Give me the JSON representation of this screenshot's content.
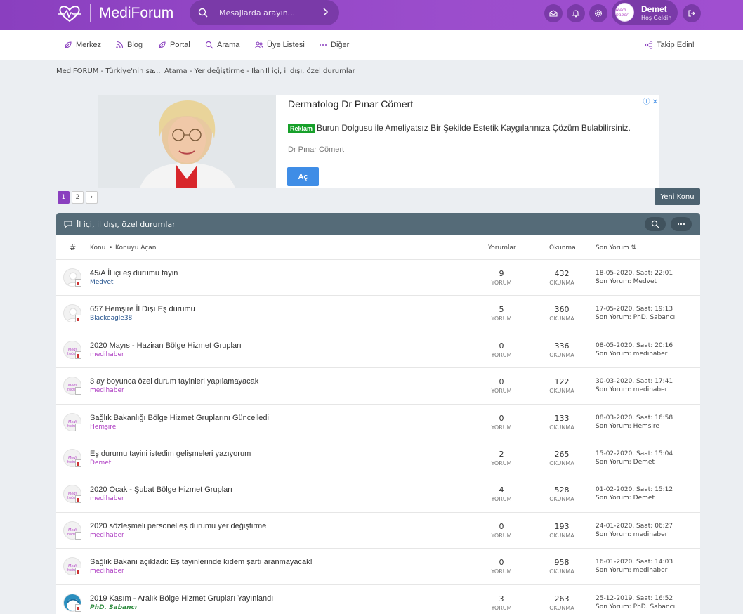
{
  "app": {
    "logo_text": "MediForum",
    "search_placeholder": "Mesajlarda arayın...",
    "user": {
      "name": "Demet",
      "greeting": "Hoş Geldin",
      "avatar_label": "Medi haber"
    }
  },
  "nav": {
    "items": [
      {
        "label": "Merkez",
        "icon": "leaf-icon"
      },
      {
        "label": "Blog",
        "icon": "rss-icon"
      },
      {
        "label": "Portal",
        "icon": "leaf-icon"
      },
      {
        "label": "Arama",
        "icon": "search-icon"
      },
      {
        "label": "Üye Listesi",
        "icon": "users-icon"
      },
      {
        "label": "Diğer",
        "icon": "more-icon"
      }
    ],
    "follow_label": "Takip Edin!"
  },
  "breadcrumb": [
    "MediFORUM - Türkiye'nin sa...",
    "Atama - Yer değiştirme - İlan",
    "İl içi, il dışı, özel durumlar"
  ],
  "ad": {
    "title": "Dermatolog Dr Pınar Cömert",
    "badge": "Reklam",
    "text": "Burun Dolgusu ile Ameliyatsız Bir Şekilde Estetik Kaygılarınıza Çözüm Bulabilirsiniz.",
    "advertiser": "Dr Pınar Cömert",
    "button": "Aç"
  },
  "pagination": {
    "pages": [
      "1",
      "2"
    ],
    "current": "1",
    "next": "›"
  },
  "new_topic_label": "Yeni Konu",
  "forum": {
    "title": "İl içi, il dışı, özel durumlar",
    "columns": {
      "hash": "#",
      "topic": "Konu",
      "starter": "Konuyu Açan",
      "replies": "Yorumlar",
      "views": "Okunma",
      "last": "Son Yorum"
    },
    "reply_unit": "YORUM",
    "view_unit": "OKUNMA",
    "last_prefix": "Son Yorum:",
    "topics": [
      {
        "title": "45/A İl içi eş durumu tayin",
        "author": "Medvet",
        "author_color": "#1f4f8b",
        "avatar": "blank",
        "doc": "red",
        "replies": "9",
        "views": "432",
        "date": "18-05-2020, Saat: 22:01",
        "last_user": "Medvet"
      },
      {
        "title": "657 Hemşire İl Dışı Eş durumu",
        "author": "Blackeagle38",
        "author_color": "#1f4f8b",
        "avatar": "blank",
        "doc": "red",
        "replies": "5",
        "views": "360",
        "date": "17-05-2020, Saat: 19:13",
        "last_user": "PhD. Sabancı"
      },
      {
        "title": "2020 Mayıs - Haziran Bölge Hizmet Grupları",
        "author": "medihaber",
        "author_color": "#b042c4",
        "avatar": "medi",
        "doc": "red",
        "replies": "0",
        "views": "336",
        "date": "08-05-2020, Saat: 20:16",
        "last_user": "medihaber"
      },
      {
        "title": "3 ay boyunca özel durum tayinleri yapılamayacak",
        "author": "medihaber",
        "author_color": "#b042c4",
        "avatar": "medi",
        "doc": "plain",
        "replies": "0",
        "views": "122",
        "date": "30-03-2020, Saat: 17:41",
        "last_user": "medihaber"
      },
      {
        "title": "Sağlık Bakanlığı Bölge Hizmet Gruplarını Güncelledi",
        "author": "Hemşire",
        "author_color": "#b042c4",
        "avatar": "medi",
        "doc": "plain",
        "replies": "0",
        "views": "133",
        "date": "08-03-2020, Saat: 16:58",
        "last_user": "Hemşire"
      },
      {
        "title": "Eş durumu tayini istedim gelişmeleri yazıyorum",
        "author": "Demet",
        "author_color": "#b042c4",
        "avatar": "medi",
        "doc": "red",
        "replies": "2",
        "views": "265",
        "date": "15-02-2020, Saat: 15:04",
        "last_user": "Demet"
      },
      {
        "title": "2020 Ocak - Şubat Bölge Hizmet Grupları",
        "author": "medihaber",
        "author_color": "#b042c4",
        "avatar": "medi",
        "doc": "red",
        "replies": "4",
        "views": "528",
        "date": "01-02-2020, Saat: 15:12",
        "last_user": "Demet"
      },
      {
        "title": "2020 sözleşmeli personel eş durumu yer değiştirme",
        "author": "medihaber",
        "author_color": "#b042c4",
        "avatar": "medi",
        "doc": "plain",
        "replies": "0",
        "views": "193",
        "date": "24-01-2020, Saat: 06:27",
        "last_user": "medihaber"
      },
      {
        "title": "Sağlık Bakanı açıkladı: Eş tayinlerinde kıdem şartı aranmayacak!",
        "author": "medihaber",
        "author_color": "#b042c4",
        "avatar": "medi",
        "doc": "red",
        "replies": "0",
        "views": "958",
        "date": "16-01-2020, Saat: 14:03",
        "last_user": "medihaber"
      },
      {
        "title": "2019 Kasım - Aralık Bölge Hizmet Grupları Yayınlandı",
        "author": "PhD. Sabancı",
        "author_color": "#2e8b3e",
        "avatar": "phd",
        "doc": "red",
        "replies": "3",
        "views": "263",
        "date": "25-12-2019, Saat: 16:52",
        "last_user": "PhD. Sabancı"
      }
    ]
  },
  "colors": {
    "brand": "#9b4dcc",
    "forum_header": "#556b78",
    "ad_button": "#3f8de6",
    "ad_badge": "#17a02a"
  }
}
